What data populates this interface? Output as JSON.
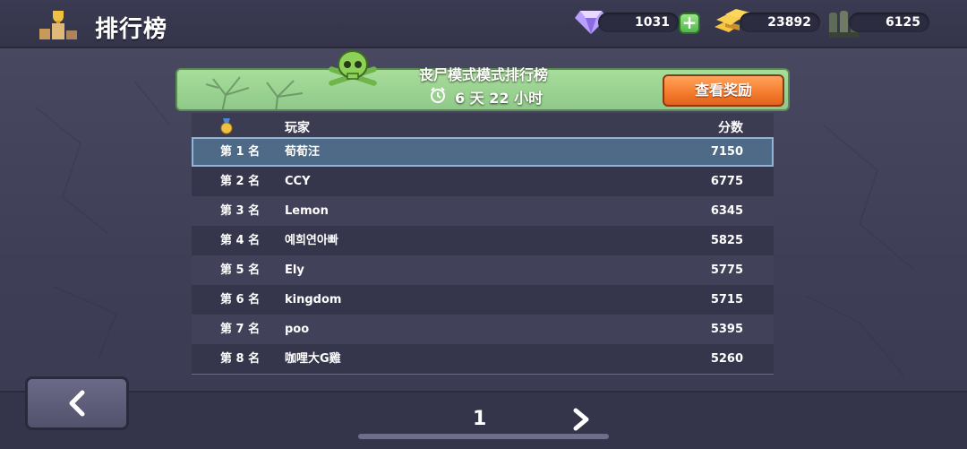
{
  "header": {
    "title": "排行榜",
    "currencies": {
      "gems": "1031",
      "gold": "23892",
      "ammo": "6125"
    }
  },
  "event": {
    "title": "丧尸模式模式排行榜",
    "countdown": "6 天 22 小时",
    "reward_button": "查看奖励"
  },
  "table": {
    "headers": {
      "player": "玩家",
      "score": "分数"
    },
    "rows": [
      {
        "rank": "第 1 名",
        "player": "荀荀汪",
        "score": "7150"
      },
      {
        "rank": "第 2 名",
        "player": "CCY",
        "score": "6775"
      },
      {
        "rank": "第 3 名",
        "player": "Lemon",
        "score": "6345"
      },
      {
        "rank": "第 4 名",
        "player": "예희연아빠",
        "score": "5825"
      },
      {
        "rank": "第 5 名",
        "player": "Ely",
        "score": "5775"
      },
      {
        "rank": "第 6 名",
        "player": "kingdom",
        "score": "5715"
      },
      {
        "rank": "第 7 名",
        "player": "poo",
        "score": "5395"
      },
      {
        "rank": "第 8 名",
        "player": "咖哩大G雞",
        "score": "5260"
      }
    ]
  },
  "pagination": {
    "page": "1"
  },
  "colors": {
    "background": "#44445c",
    "banner_green": "#9ed492",
    "reward_orange": "#f47a2c",
    "selected_row": "#4e6a86"
  }
}
